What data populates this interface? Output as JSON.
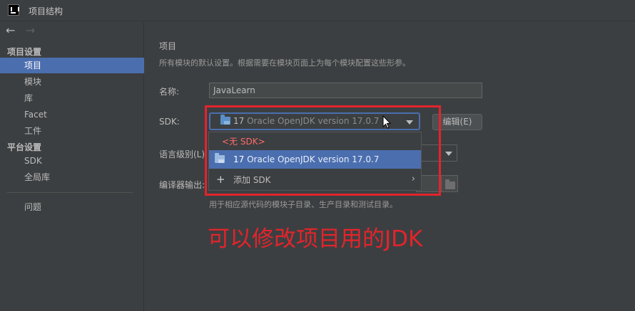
{
  "window": {
    "title": "项目结构"
  },
  "colors": {
    "accent": "#4b6eaf",
    "annotation_red": "#e3242b",
    "error_red": "#ff6b68"
  },
  "nav": {
    "back_icon": "←",
    "forward_icon": "→"
  },
  "sidebar": {
    "project_settings_header": "项目设置",
    "project_settings_items": [
      "项目",
      "模块",
      "库",
      "Facet",
      "工件"
    ],
    "platform_settings_header": "平台设置",
    "platform_settings_items": [
      "SDK",
      "全局库"
    ],
    "problems_item": "问题",
    "selected": "项目"
  },
  "main": {
    "title": "项目",
    "description": "所有模块的默认设置。根据需要在模块页面上为每个模块配置这些形参。",
    "name_label": "名称:",
    "name_value": "JavaLearn",
    "sdk_label": "SDK:",
    "sdk_selected_version": "17",
    "sdk_selected_name": "Oracle OpenJDK version 17.0.7",
    "edit_button": "编辑(E)",
    "language_level_label": "语言级别(L):",
    "compiler_output_label": "编译器输出:",
    "compiler_output_hint": "用于相应源代码的模块子目录、生产目录和测试目录。"
  },
  "dropdown": {
    "no_sdk": "<无 SDK>",
    "jdk_item": {
      "version": "17",
      "name": "Oracle OpenJDK version 17.0.7"
    },
    "add_sdk": "添加 SDK"
  },
  "annotation": {
    "text": "可以修改项目用的JDK"
  }
}
